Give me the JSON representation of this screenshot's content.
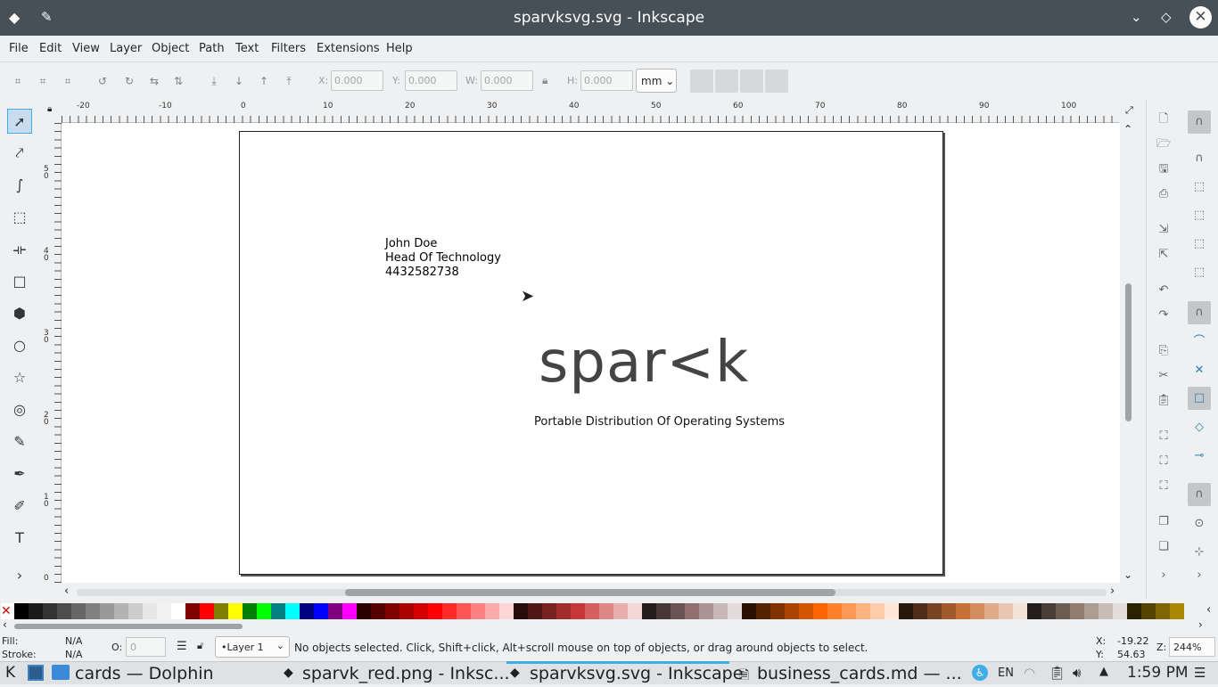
{
  "window": {
    "title": "sparvksvg.svg - Inkscape",
    "accent": "#475057"
  },
  "menu": [
    "File",
    "Edit",
    "View",
    "Layer",
    "Object",
    "Path",
    "Text",
    "Filters",
    "Extensions",
    "Help"
  ],
  "toolbar": {
    "x_label": "X:",
    "x_value": "0.000",
    "y_label": "Y:",
    "y_value": "0.000",
    "w_label": "W:",
    "w_value": "0.000",
    "h_label": "H:",
    "h_value": "0.000",
    "unit": "mm"
  },
  "ruler": {
    "h_ticks": [
      "-20",
      "-10",
      "0",
      "10",
      "20",
      "30",
      "40",
      "50",
      "60",
      "70",
      "80",
      "90",
      "100"
    ],
    "v_ticks": [
      "5\n0",
      "4\n0",
      "3\n0",
      "2\n0",
      "1\n0",
      "0"
    ]
  },
  "canvas": {
    "card_lines": [
      "John Doe",
      "Head Of Technology",
      "4432582738"
    ],
    "logo": "spar<k",
    "tagline": "Portable Distribution Of Operating Systems"
  },
  "status": {
    "fill_label": "Fill:",
    "fill_value": "N/A",
    "stroke_label": "Stroke:",
    "stroke_value": "N/A",
    "opacity_label": "O:",
    "opacity_value": "0",
    "layer": "•Layer 1",
    "message": "No objects selected. Click, Shift+click, Alt+scroll mouse on top of objects, or drag around objects to select.",
    "x_label": "X:",
    "x_value": "-19.22",
    "y_label": "Y:",
    "y_value": "54.63",
    "zoom_label": "Z:",
    "zoom_value": "244%"
  },
  "taskbar": {
    "items": [
      "cards — Dolphin",
      "sparvk_red.png - Inksc...",
      "sparvksvg.svg - Inkscape",
      "business_cards.md — ..."
    ],
    "lang": "EN",
    "clock": "1:59 PM"
  },
  "palette_colors": [
    "#000000",
    "#1a1a1a",
    "#333333",
    "#4d4d4d",
    "#666666",
    "#808080",
    "#999999",
    "#b3b3b3",
    "#cccccc",
    "#e6e6e6",
    "#f2f2f2",
    "#ffffff",
    "#800000",
    "#ff0000",
    "#808000",
    "#ffff00",
    "#008000",
    "#00ff00",
    "#008080",
    "#00ffff",
    "#000080",
    "#0000ff",
    "#800080",
    "#ff00ff",
    "#2b0000",
    "#550000",
    "#800000",
    "#aa0000",
    "#d40000",
    "#ff0000",
    "#ff2a2a",
    "#ff5555",
    "#ff8080",
    "#ffaaaa",
    "#ffd5d5",
    "#280b0b",
    "#501616",
    "#782121",
    "#a02c2c",
    "#c83737",
    "#d35f5f",
    "#de8787",
    "#e9afaf",
    "#f4d7d7",
    "#241c1c",
    "#483737",
    "#6c5353",
    "#916f6f",
    "#ac9393",
    "#c8b7b7",
    "#e3dbdb",
    "#2b1100",
    "#552200",
    "#803300",
    "#aa4400",
    "#d45500",
    "#ff6600",
    "#ff7f2a",
    "#ff9955",
    "#ffb380",
    "#ffccaa",
    "#ffe6d5",
    "#28170b",
    "#502d16",
    "#784421",
    "#a05a2c",
    "#c87137",
    "#d38d5f",
    "#deaa87",
    "#e9c6af",
    "#f4e3d7",
    "#241f1c",
    "#483e37",
    "#6c5d53",
    "#917c6f",
    "#ac9d93",
    "#c8beb7",
    "#e3dedb",
    "#2b2200",
    "#554400",
    "#806600",
    "#aa8800"
  ]
}
